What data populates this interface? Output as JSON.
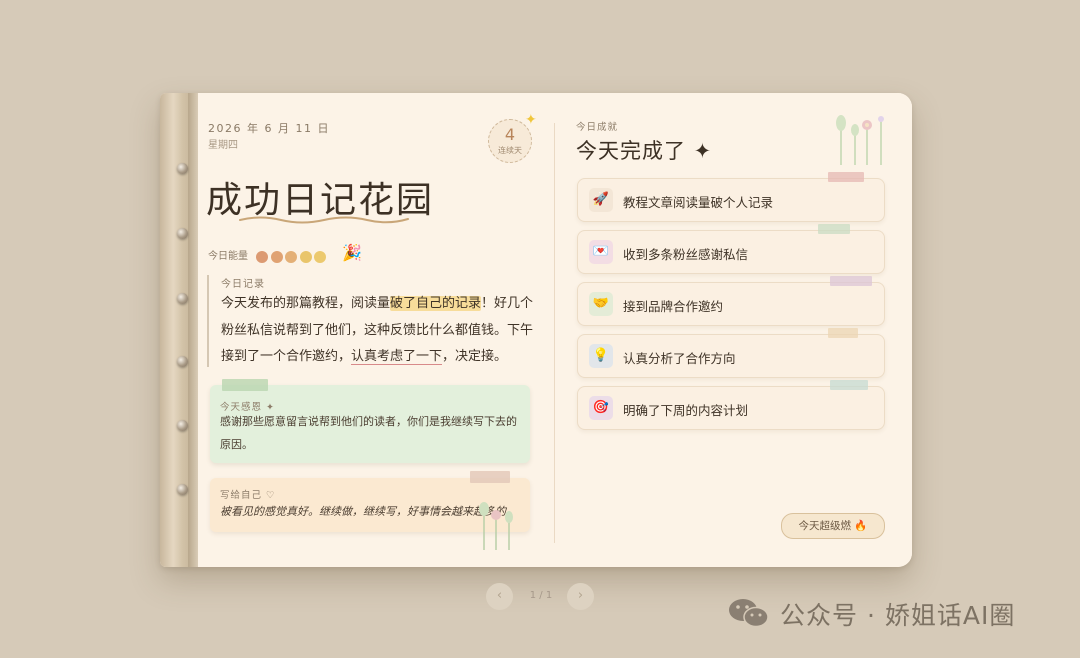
{
  "journal": {
    "date": "2026 年 6 月 11 日",
    "weekday": "星期四",
    "streak": {
      "count": "4",
      "label": "连续天"
    },
    "title": "成功日记花园",
    "energy": {
      "label": "今日能量",
      "dot_colors": [
        "#dc9a72",
        "#e0a272",
        "#e4b077",
        "#e9c56b",
        "#ecc96e"
      ],
      "emoji": "🎉"
    },
    "log": {
      "label": "今日记录",
      "text_1": "今天发布的那篇教程，阅读量",
      "highlight": "破了自己的记录",
      "text_2": "！好几个粉丝私信说帮到了他们，这种反馈比什么都值钱。下午接到了一个合作邀约，",
      "underline": "认真考虑了一下",
      "text_3": "，决定接。"
    },
    "gratitude": {
      "label": "今天感恩 ✦",
      "text": "感谢那些愿意留言说帮到他们的读者，你们是我继续写下去的原因。"
    },
    "self_note": {
      "label": "写给自己 ♡",
      "text": "被看见的感觉真好。继续做，继续写，好事情会越来越多的。"
    }
  },
  "achievements": {
    "small_label": "今日成就",
    "title": "今天完成了 ✦",
    "items": [
      {
        "icon": "rocket-icon",
        "emoji": "🚀",
        "bg": "#f3e6d6",
        "tape": "#e6b8b3",
        "label": "教程文章阅读量破个人记录"
      },
      {
        "icon": "love-letter-icon",
        "emoji": "💌",
        "bg": "#f3dde4",
        "tape": "#c9dcc3",
        "label": "收到多条粉丝感谢私信"
      },
      {
        "icon": "handshake-icon",
        "emoji": "🤝",
        "bg": "#e4ecd7",
        "tape": "#dcc5d6",
        "label": "接到品牌合作邀约"
      },
      {
        "icon": "lightbulb-icon",
        "emoji": "💡",
        "bg": "#e2e6ea",
        "tape": "#ecd6b3",
        "label": "认真分析了合作方向"
      },
      {
        "icon": "target-icon",
        "emoji": "🎯",
        "bg": "#ecdde8",
        "tape": "#c6dbd1",
        "label": "明确了下周的内容计划"
      }
    ],
    "badge": "今天超级燃 🔥"
  },
  "pager": {
    "prev": "‹",
    "next": "›",
    "page": "1 / 1"
  },
  "watermark": {
    "text": "公众号 · 娇姐话AI圈"
  }
}
